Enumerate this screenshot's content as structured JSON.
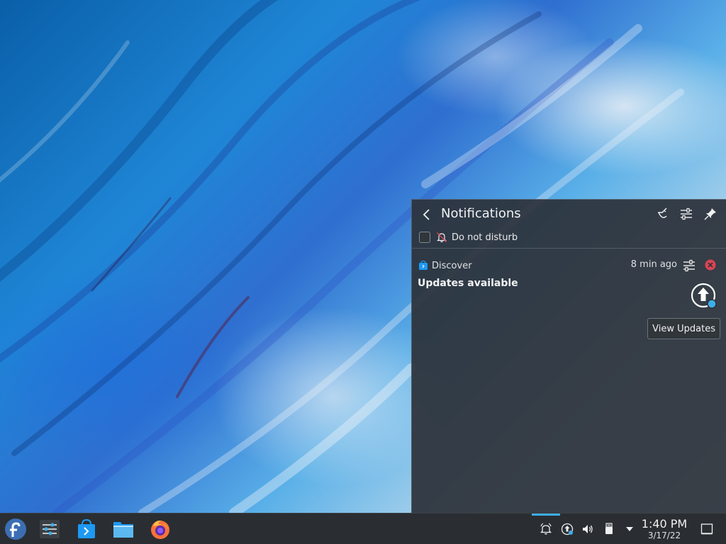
{
  "notifications_panel": {
    "title": "Notifications",
    "dnd_label": "Do not disturb",
    "dnd_checked": false,
    "header_icons": [
      "clear-all-icon",
      "configure-icon",
      "pin-icon"
    ]
  },
  "notification": {
    "app_name": "Discover",
    "time": "8 min ago",
    "summary": "Updates available",
    "action_label": "View Updates"
  },
  "taskbar": {
    "launchers": [
      "fedora-menu-icon",
      "system-settings-icon",
      "discover-icon",
      "dolphin-file-manager-icon",
      "firefox-icon"
    ],
    "tray": [
      "notifications-bell-icon",
      "updates-icon",
      "volume-icon",
      "device-notifier-icon",
      "expand-tray-icon"
    ],
    "clock_time": "1:40 PM",
    "clock_date": "3/17/22"
  },
  "colors": {
    "panel_bg": "#2c323a",
    "taskbar_bg": "#2a2e32",
    "accent": "#3daee9",
    "close_red": "#da4453"
  }
}
